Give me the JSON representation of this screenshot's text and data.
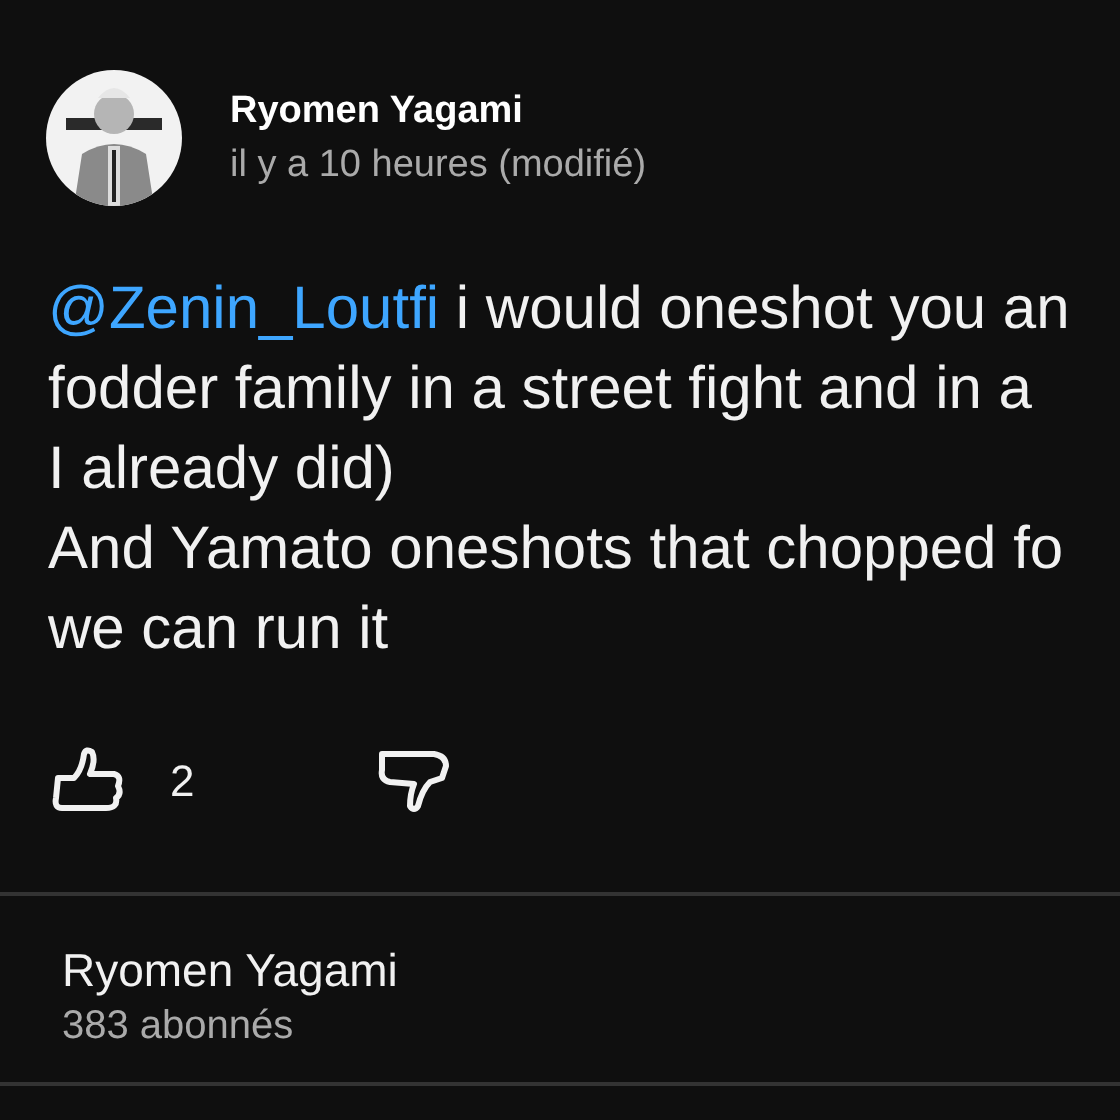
{
  "comment": {
    "author": "Ryomen Yagami",
    "time": "il y a 10 heures (modifié)",
    "mention": "@Zenin_Loutfi",
    "lines": [
      " i would oneshot you an",
      "fodder family in a street fight and in a",
      "I already did)",
      "And Yamato oneshots that chopped fo",
      "we can run it"
    ],
    "likes": "2",
    "liked": false,
    "disliked": false
  },
  "channel": {
    "name": "Ryomen Yagami",
    "subscribers": "383 abonnés"
  }
}
